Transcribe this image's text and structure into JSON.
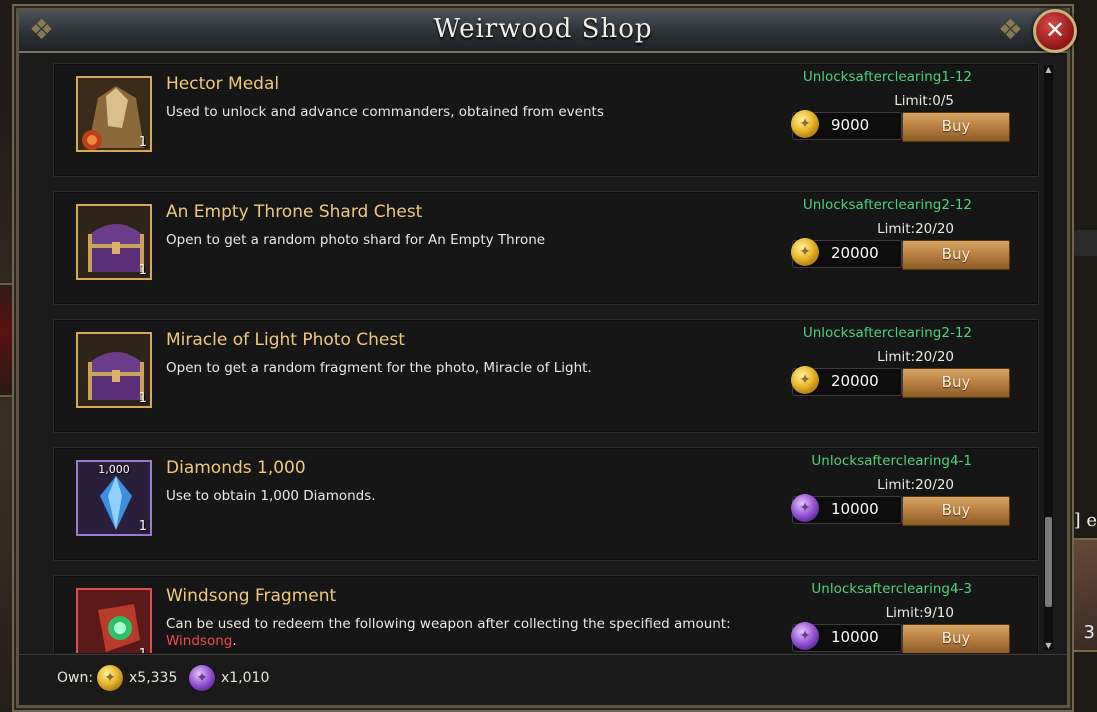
{
  "shop": {
    "title": "Weirwood Shop",
    "close_icon": "close-icon"
  },
  "colors": {
    "item_name": "#f0c979",
    "unlock_text": "#4fd27a",
    "buy_button": "#b27a3c",
    "highlight_red": "#ef4a4a"
  },
  "items": [
    {
      "name": "Hector Medal",
      "description": "Used to unlock and advance commanders, obtained from events",
      "unlock": "Unlocksafterclearing1-12",
      "limit": "Limit:0/5",
      "price": "9000",
      "currency": "gold-coin",
      "quantity": "1",
      "buy_label": "Buy",
      "icon": "medal-icon"
    },
    {
      "name": "An Empty Throne Shard Chest",
      "description": "Open to get a random photo shard for An Empty Throne",
      "unlock": "Unlocksafterclearing2-12",
      "limit": "Limit:20/20",
      "price": "20000",
      "currency": "gold-coin",
      "quantity": "1",
      "buy_label": "Buy",
      "icon": "chest-icon"
    },
    {
      "name": "Miracle of Light Photo Chest",
      "description": "Open to get a random fragment for the photo, Miracle of Light.",
      "unlock": "Unlocksafterclearing2-12",
      "limit": "Limit:20/20",
      "price": "20000",
      "currency": "gold-coin",
      "quantity": "1",
      "buy_label": "Buy",
      "icon": "chest-icon"
    },
    {
      "name": "Diamonds 1,000",
      "description": "Use to obtain 1,000 Diamonds.",
      "badge": "1,000",
      "unlock": "Unlocksafterclearing4-1",
      "limit": "Limit:20/20",
      "price": "10000",
      "currency": "purple-coin",
      "quantity": "1",
      "buy_label": "Buy",
      "icon": "diamond-icon"
    },
    {
      "name": "Windsong Fragment",
      "description": "Can be used to redeem the following weapon after collecting the specified amount:",
      "description_highlight": "Windsong",
      "description_end": ".",
      "unlock": "Unlocksafterclearing4-3",
      "limit": "Limit:9/10",
      "price": "10000",
      "currency": "purple-coin",
      "quantity": "1",
      "buy_label": "Buy",
      "icon": "fragment-icon"
    }
  ],
  "footer": {
    "own_label": "Own:",
    "gold_amount": "x5,335",
    "purple_amount": "x1,010"
  },
  "background": {
    "right_text": "] e",
    "right_num": "3"
  }
}
